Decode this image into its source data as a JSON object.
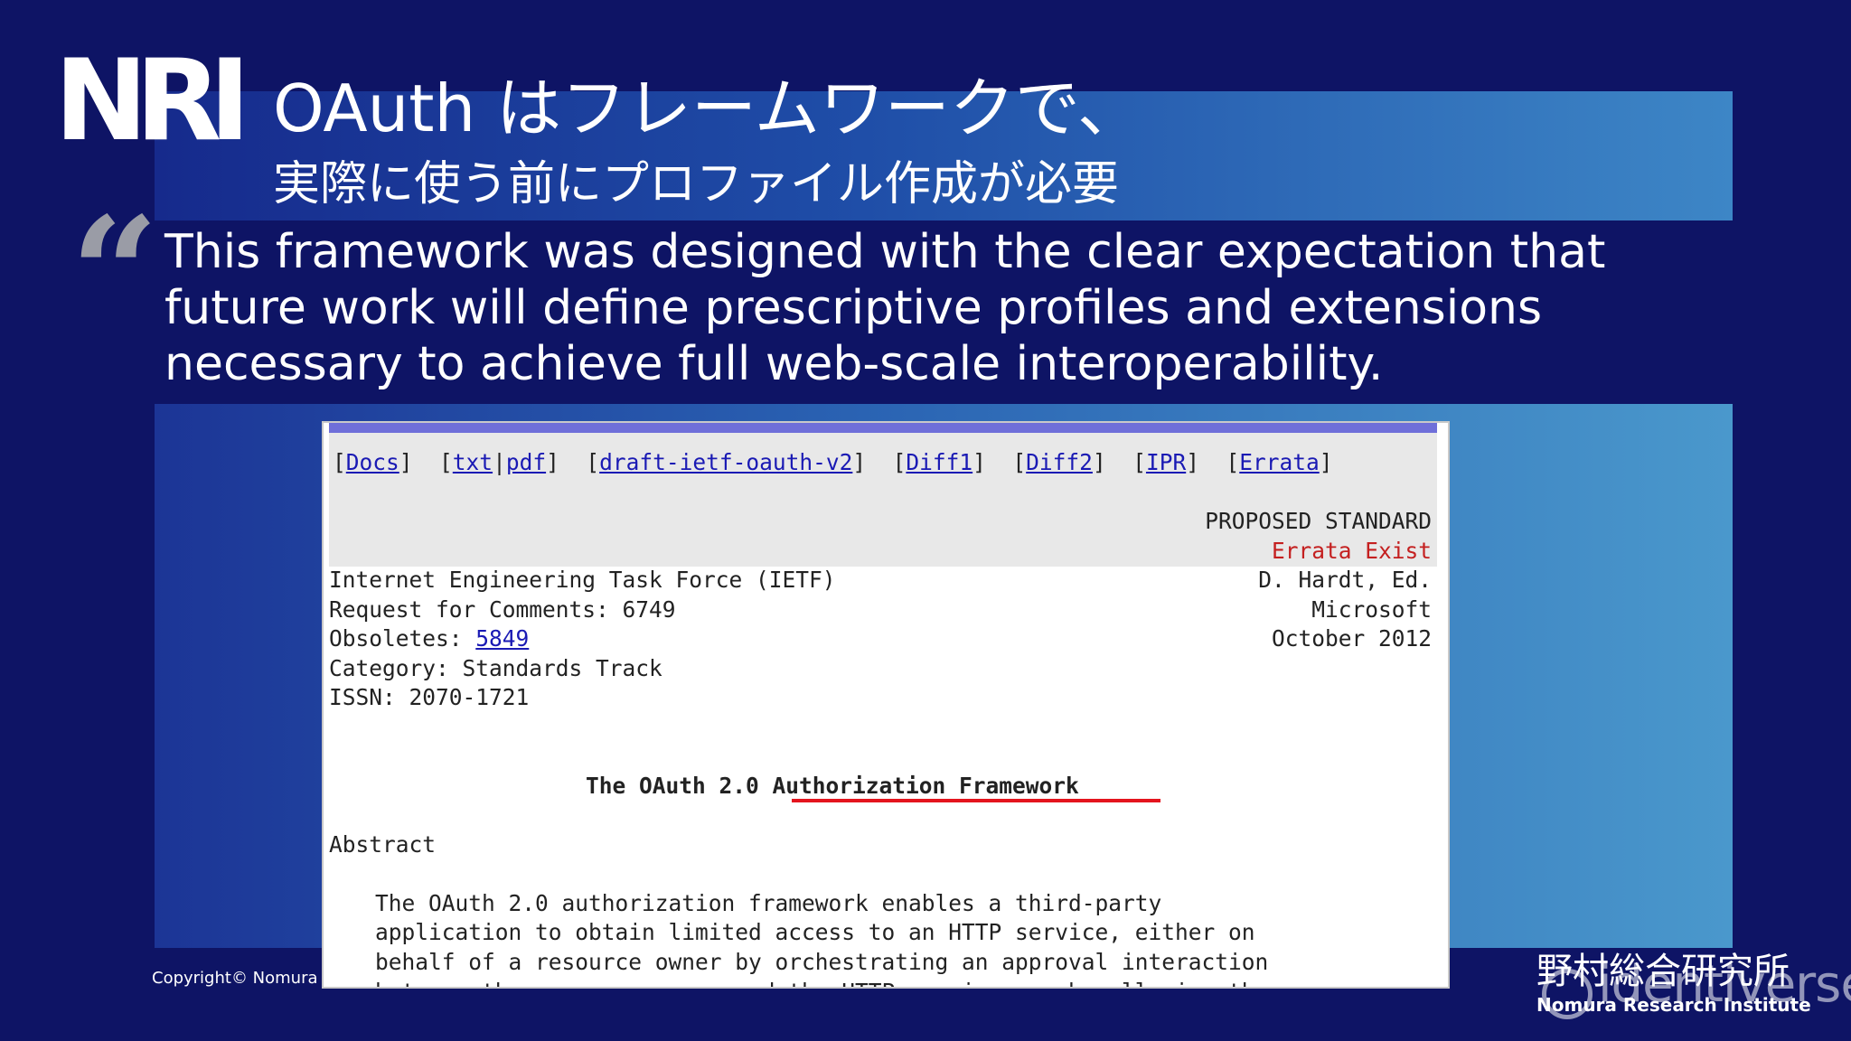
{
  "logo": "NRI",
  "title": {
    "line1": "OAuth はフレームワークで、",
    "line2": "実際に使う前にプロファイル作成が必要"
  },
  "quote": {
    "mark": "“",
    "text": "This framework was designed with the clear expectation that future work will define prescriptive profiles and extensions necessary to achieve full web-scale interoperability."
  },
  "document": {
    "nav": {
      "docs": "Docs",
      "txt": "txt",
      "pdf": "pdf",
      "draft": "draft-ietf-oauth-v2",
      "diff1": "Diff1",
      "diff2": "Diff2",
      "ipr": "IPR",
      "errata": "Errata"
    },
    "status": "PROPOSED STANDARD",
    "errata_exist": "Errata Exist",
    "meta_left": {
      "org": "Internet Engineering Task Force (IETF)",
      "rfc": "Request for Comments: 6749",
      "obsoletes_label": "Obsoletes: ",
      "obsoletes_link": "5849",
      "category": "Category: Standards Track",
      "issn": "ISSN: 2070-1721"
    },
    "meta_right": {
      "author": "D. Hardt, Ed.",
      "company": "Microsoft",
      "date": "October 2012"
    },
    "doc_title": "The OAuth 2.0 Authorization Framework",
    "abstract_heading": "Abstract",
    "abstract_lines": [
      "The OAuth 2.0 authorization framework enables a third-party",
      "application to obtain limited access to an HTTP service, either on",
      "behalf of a resource owner by orchestrating an approval interaction",
      "between the resource owner and the HTTP service, or by allowing the"
    ]
  },
  "footer": {
    "copyright": "Copyright© Nomura",
    "brand_jp": "野村総合研究所",
    "brand_en": "Nomura Research Institute",
    "watermark": "identiverse"
  },
  "colors": {
    "background": "#0e1465",
    "link": "#1a1ab4",
    "errata": "#c42020",
    "highlight_underline": "#e4141e"
  }
}
